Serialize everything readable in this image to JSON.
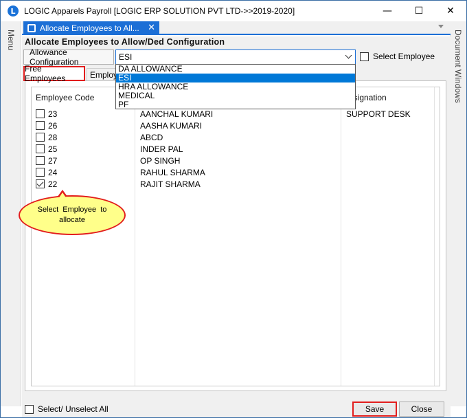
{
  "window": {
    "title": "LOGIC Apparels Payroll  [LOGIC ERP SOLUTION PVT LTD->>2019-2020]",
    "app_logo_letter": "L",
    "minimize_glyph": "—",
    "maximize_glyph": "☐",
    "close_glyph": "✕"
  },
  "side": {
    "left_label": "Menu",
    "right_label": "Document Windows"
  },
  "doc_tab": {
    "label": "Allocate Employees to All...",
    "close_glyph": "✕"
  },
  "form": {
    "title": "Allocate Employees to Allow/Ded Configuration",
    "config_label": "Allowance Configuration",
    "config_value": "ESI",
    "select_employee_label": "Select Employee",
    "select_employee_checked": false
  },
  "dropdown": {
    "options": [
      "DA ALLOWANCE",
      "ESI",
      "HRA ALLOWANCE",
      "MEDICAL",
      "PF"
    ],
    "selected_index": 1
  },
  "tabs": {
    "free_employees": "Free Employees",
    "employees_partial": "Employe"
  },
  "grid": {
    "headers": {
      "code": "Employee Code",
      "designation": "esignation"
    },
    "rows": [
      {
        "checked": false,
        "code": "23",
        "name": "AANCHAL KUMARI",
        "designation": "SUPPORT DESK"
      },
      {
        "checked": false,
        "code": "26",
        "name": "AASHA KUMARI",
        "designation": ""
      },
      {
        "checked": false,
        "code": "28",
        "name": "ABCD",
        "designation": ""
      },
      {
        "checked": false,
        "code": "25",
        "name": "INDER PAL",
        "designation": ""
      },
      {
        "checked": false,
        "code": "27",
        "name": "OP SINGH",
        "designation": ""
      },
      {
        "checked": false,
        "code": "24",
        "name": "RAHUL SHARMA",
        "designation": ""
      },
      {
        "checked": true,
        "code": "22",
        "name": "RAJIT SHARMA",
        "designation": ""
      }
    ]
  },
  "callout": {
    "text": "Select Employee to allocate"
  },
  "bottom": {
    "select_all_label": "Select/ Unselect All",
    "save_label": "Save",
    "close_label": "Close"
  },
  "colors": {
    "accent": "#1c6fd6",
    "highlight_border": "#e21d1d",
    "callout_fill": "#ffff8a",
    "selection": "#0078d7"
  }
}
